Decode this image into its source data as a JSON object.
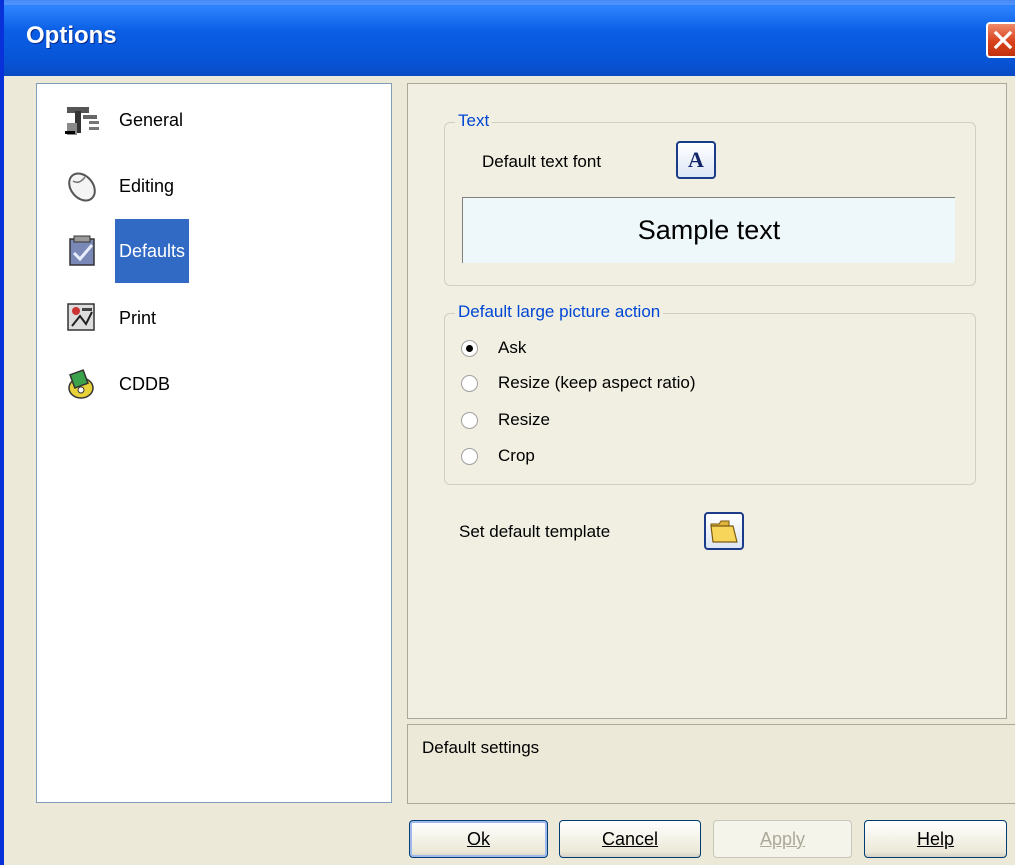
{
  "window": {
    "title": "Options"
  },
  "nav": {
    "items": [
      {
        "label": "General",
        "icon": "tools-icon"
      },
      {
        "label": "Editing",
        "icon": "mouse-icon"
      },
      {
        "label": "Defaults",
        "icon": "checklist-icon",
        "selected": true
      },
      {
        "label": "Print",
        "icon": "print-preview-icon"
      },
      {
        "label": "CDDB",
        "icon": "cd-database-icon"
      }
    ]
  },
  "text_group": {
    "title": "Text",
    "font_label": "Default text font",
    "font_button": "A",
    "sample": "Sample text"
  },
  "picture_group": {
    "title": "Default large picture action",
    "options": [
      {
        "label": "Ask",
        "checked": true
      },
      {
        "label": "Resize (keep aspect ratio)",
        "checked": false
      },
      {
        "label": "Resize",
        "checked": false
      },
      {
        "label": "Crop",
        "checked": false
      }
    ]
  },
  "template": {
    "label": "Set default template"
  },
  "status": {
    "text": "Default settings"
  },
  "buttons": {
    "ok": "Ok",
    "cancel": "Cancel",
    "apply": "Apply",
    "help": "Help"
  },
  "colors": {
    "titlebar": "#0754d6",
    "selection": "#316ac5",
    "group_title": "#0046d5",
    "close": "#d8411c"
  }
}
